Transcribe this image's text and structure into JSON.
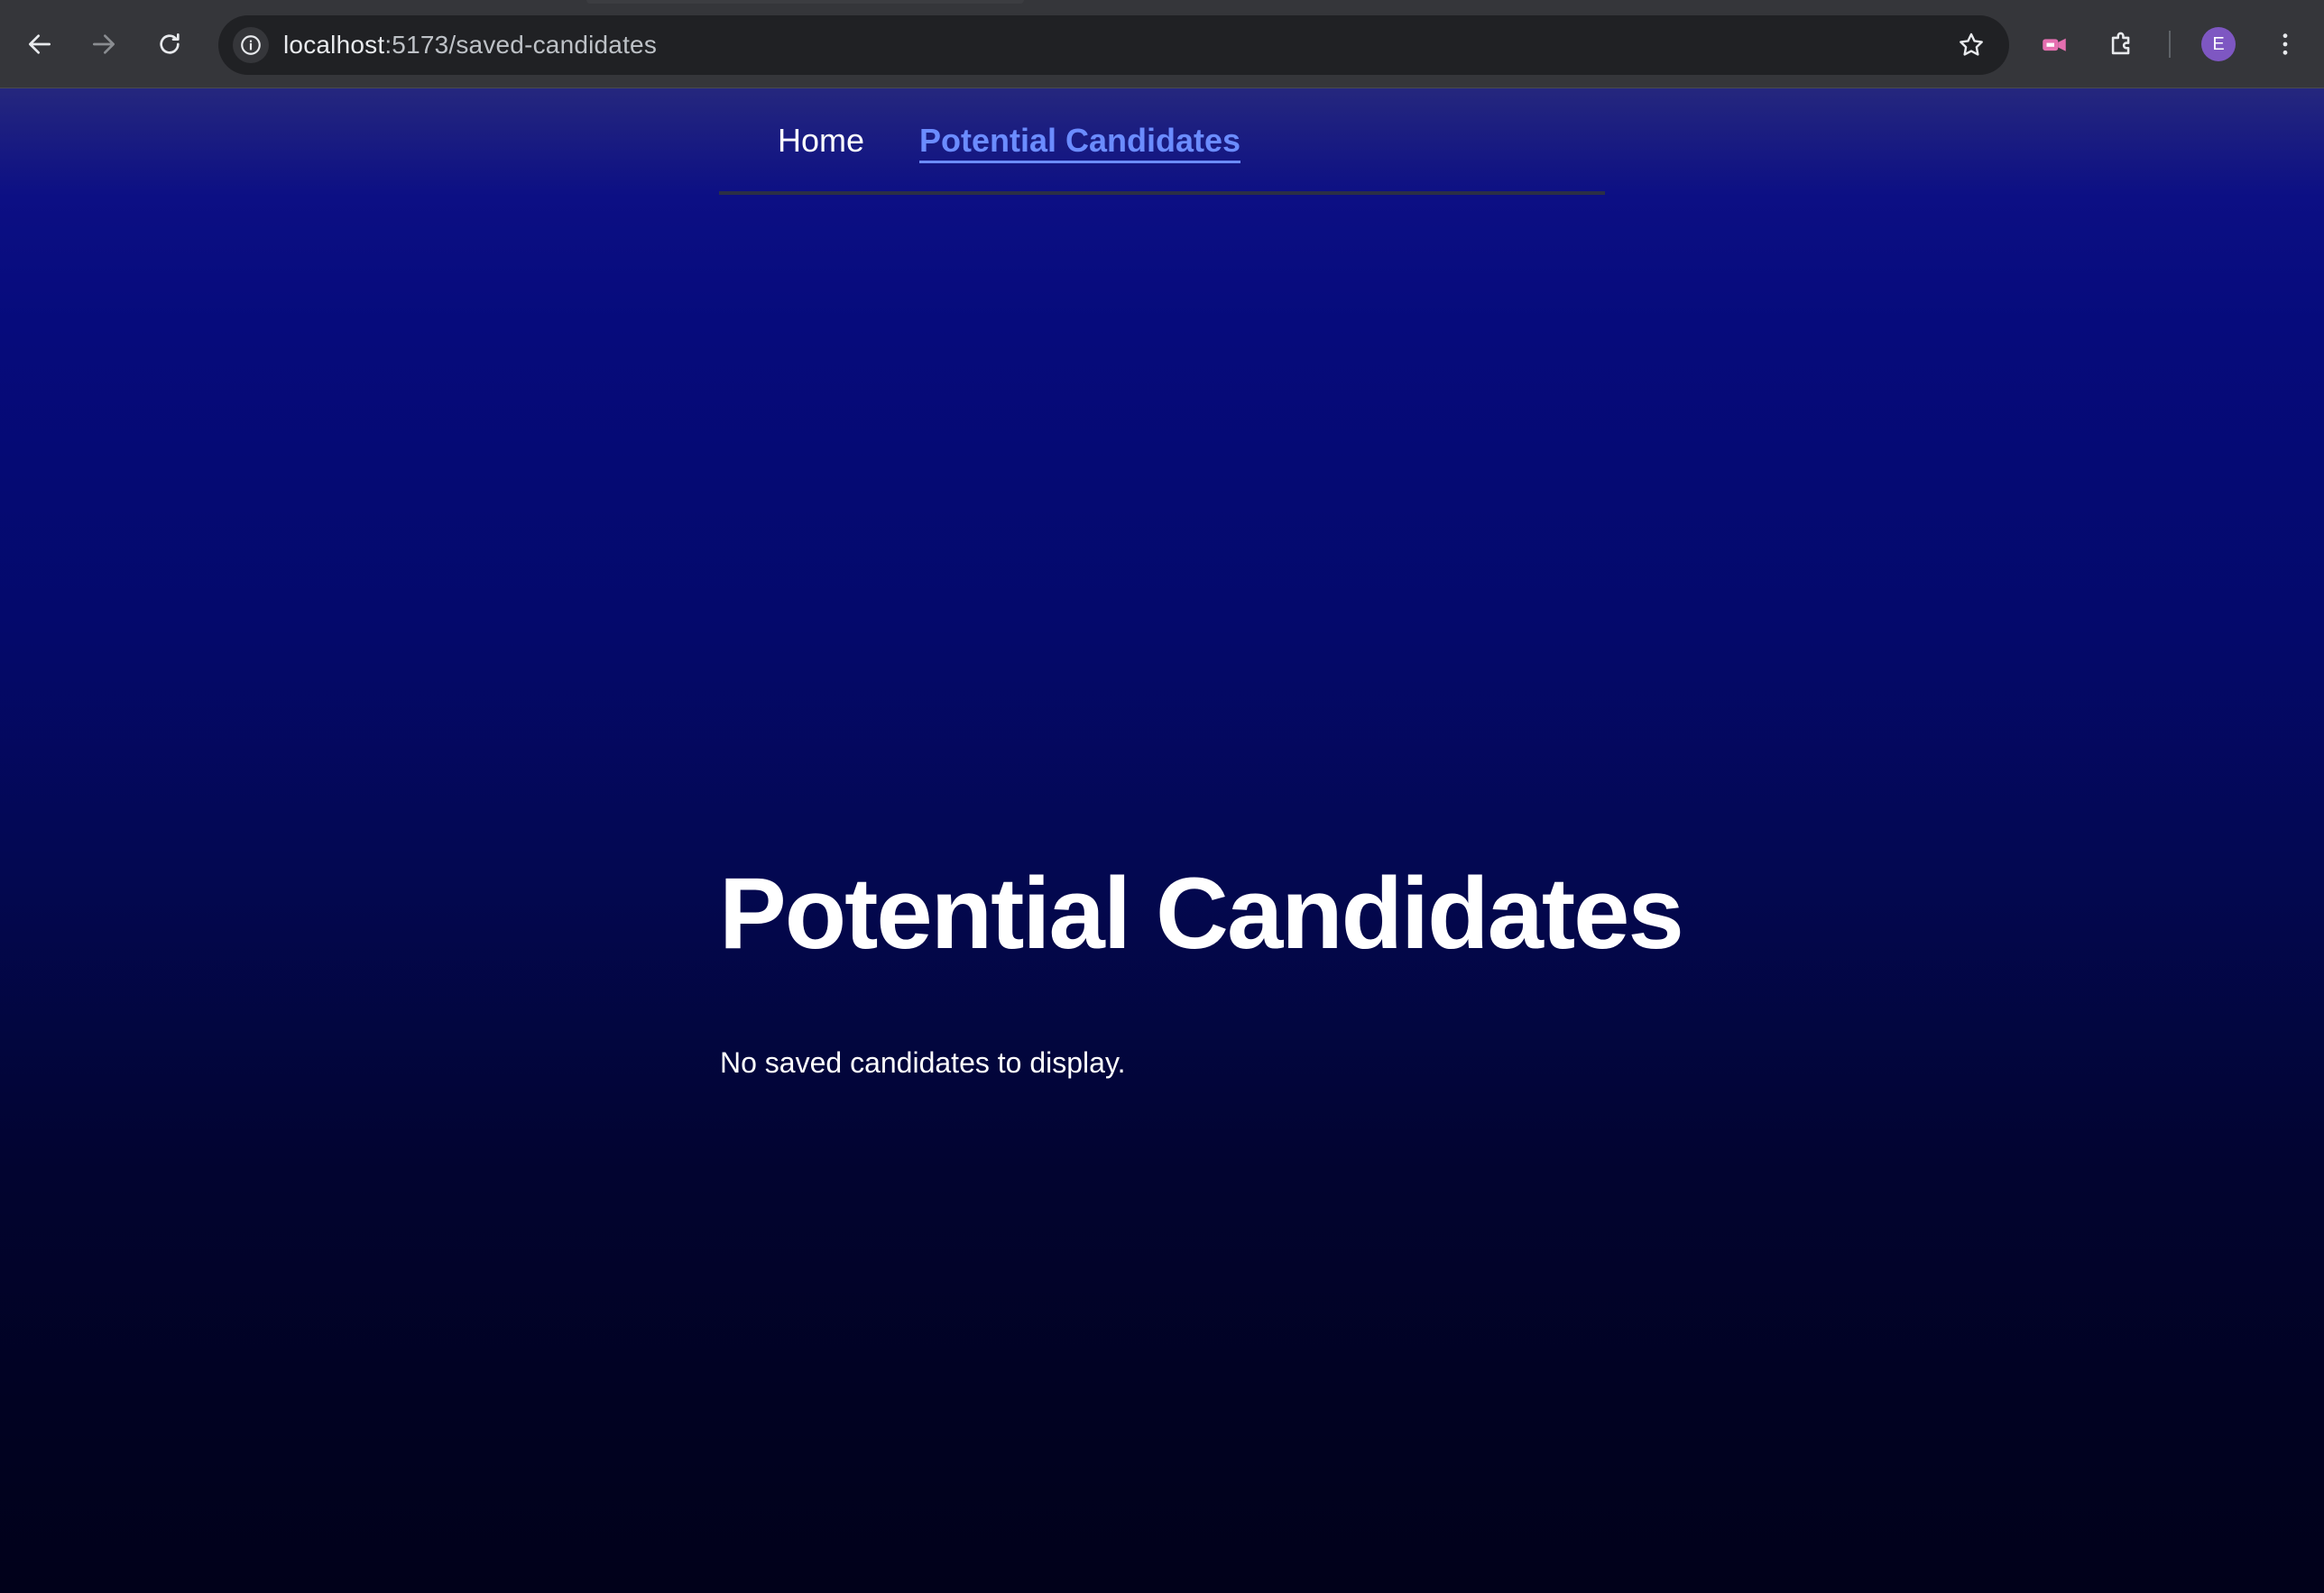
{
  "browser": {
    "url_host": "localhost",
    "url_path": ":5173/saved-candidates",
    "profile_initial": "E",
    "icons": {
      "back": "arrow-left-icon",
      "forward": "arrow-right-icon",
      "reload": "reload-icon",
      "site_info": "info-icon",
      "bookmark": "star-icon",
      "extension_media": "media-extension-icon",
      "extensions": "puzzle-icon",
      "menu": "kebab-menu-icon"
    }
  },
  "nav": {
    "home": "Home",
    "candidates": "Potential Candidates"
  },
  "main": {
    "title": "Potential Candidates",
    "empty_message": "No saved candidates to display."
  },
  "colors": {
    "active_link": "#6b8cff",
    "text": "#ffffff",
    "avatar": "#7e57c2"
  }
}
